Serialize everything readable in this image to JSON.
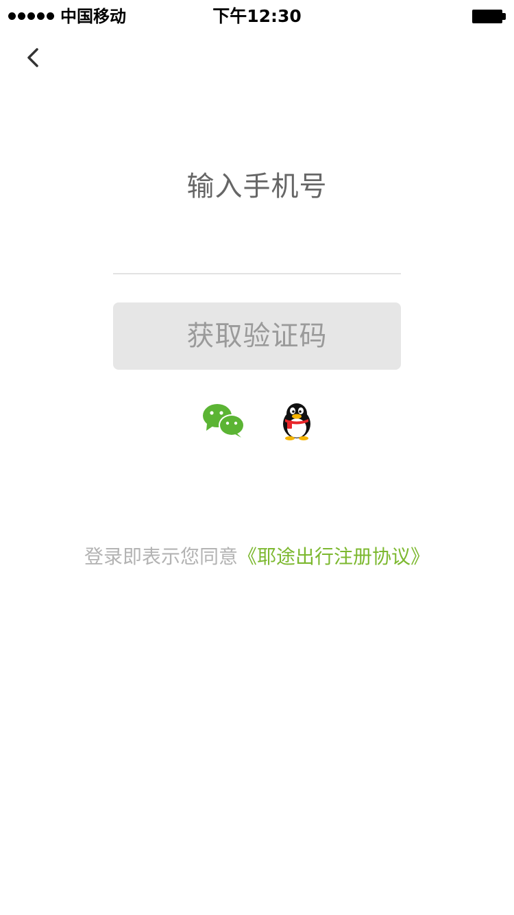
{
  "status_bar": {
    "carrier": "中国移动",
    "time": "下午12:30"
  },
  "login": {
    "title": "输入手机号",
    "phone_input": {
      "value": "",
      "placeholder": ""
    },
    "get_code_label": "获取验证码"
  },
  "social": {
    "wechat_icon": "wechat-icon",
    "qq_icon": "qq-penguin-icon",
    "wechat_color": "#5bb434"
  },
  "agreement": {
    "prefix": "登录即表示您同意",
    "link_text": "《耶途出行注册协议》",
    "link_color": "#7cb82f"
  },
  "colors": {
    "title": "#666666",
    "button_bg": "#e6e6e6",
    "button_text": "#9a9a9a",
    "muted_text": "#b3b3b3"
  }
}
